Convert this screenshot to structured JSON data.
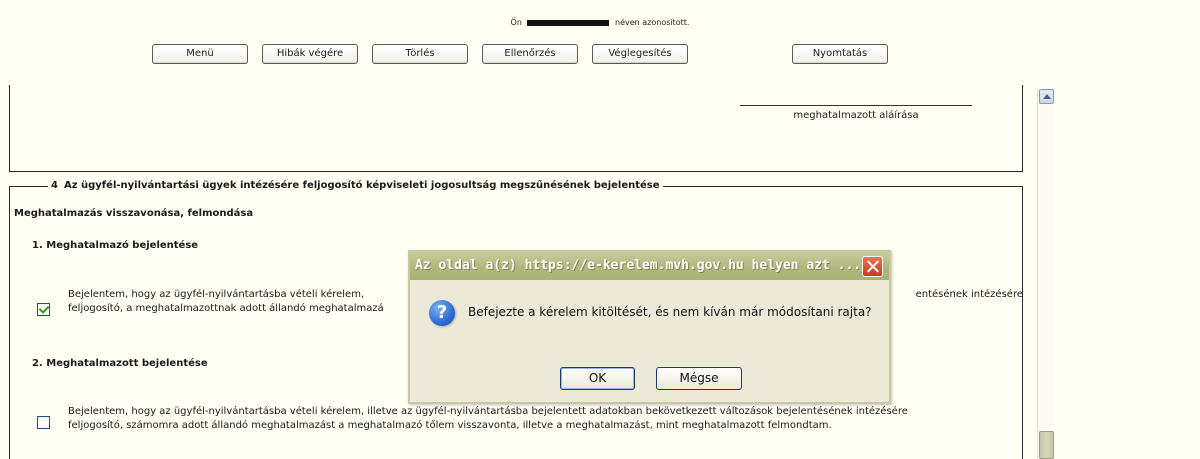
{
  "header": {
    "ident_prefix": "Ön",
    "ident_suffix": "néven azonosított."
  },
  "toolbar": {
    "menu_label": "Menü",
    "errors_end_label": "Hibák végére",
    "delete_label": "Törlés",
    "check_label": "Ellenőrzés",
    "finalize_label": "Véglegesítés",
    "print_label": "Nyomtatás"
  },
  "form": {
    "signature_label": "meghatalmazott aláírása",
    "section4": {
      "number": "4",
      "title": "Az ügyfél-nyilvántartási ügyek intézésére feljogosító képviseleti jogosultság megszűnésének bejelentése",
      "subtitle": "Meghatalmazás visszavonása, felmondása",
      "item1": {
        "title": "1. Meghatalmazó bejelentése",
        "checked": true,
        "text_line1_left": "Bejelentem, hogy az ügyfél-nyilvántartásba vételi kérelem,",
        "text_line1_right": "entésének intézésére",
        "text_line2": "feljogosító, a meghatalmazottnak adott állandó meghatalmazá"
      },
      "item2": {
        "title": "2. Meghatalmazott bejelentése",
        "checked": false,
        "text_line1": "Bejelentem, hogy az ügyfél-nyilvántartásba vételi kérelem, illetve az ügyfél-nyilvántartásba bejelentett adatokban bekövetkezett változások bejelentésének intézésére",
        "text_line2": "feljogosító, számomra adott állandó meghatalmazást a meghatalmazó tőlem visszavonta, illetve a meghatalmazást, mint meghatalmazott felmondtam."
      }
    }
  },
  "dialog": {
    "title": "Az oldal a(z) https://e-kerelem.mvh.gov.hu helyen azt ...",
    "message": "Befejezte a kérelem kitöltését, és nem kíván már módosítani rajta?",
    "ok_label": "OK",
    "cancel_label": "Mégse",
    "icon": "question-icon"
  },
  "colors": {
    "page_bg": "#fffff3",
    "dialog_title_bg": "#b0b87e",
    "close_red": "#cc3b19",
    "check_green": "#21a121"
  }
}
